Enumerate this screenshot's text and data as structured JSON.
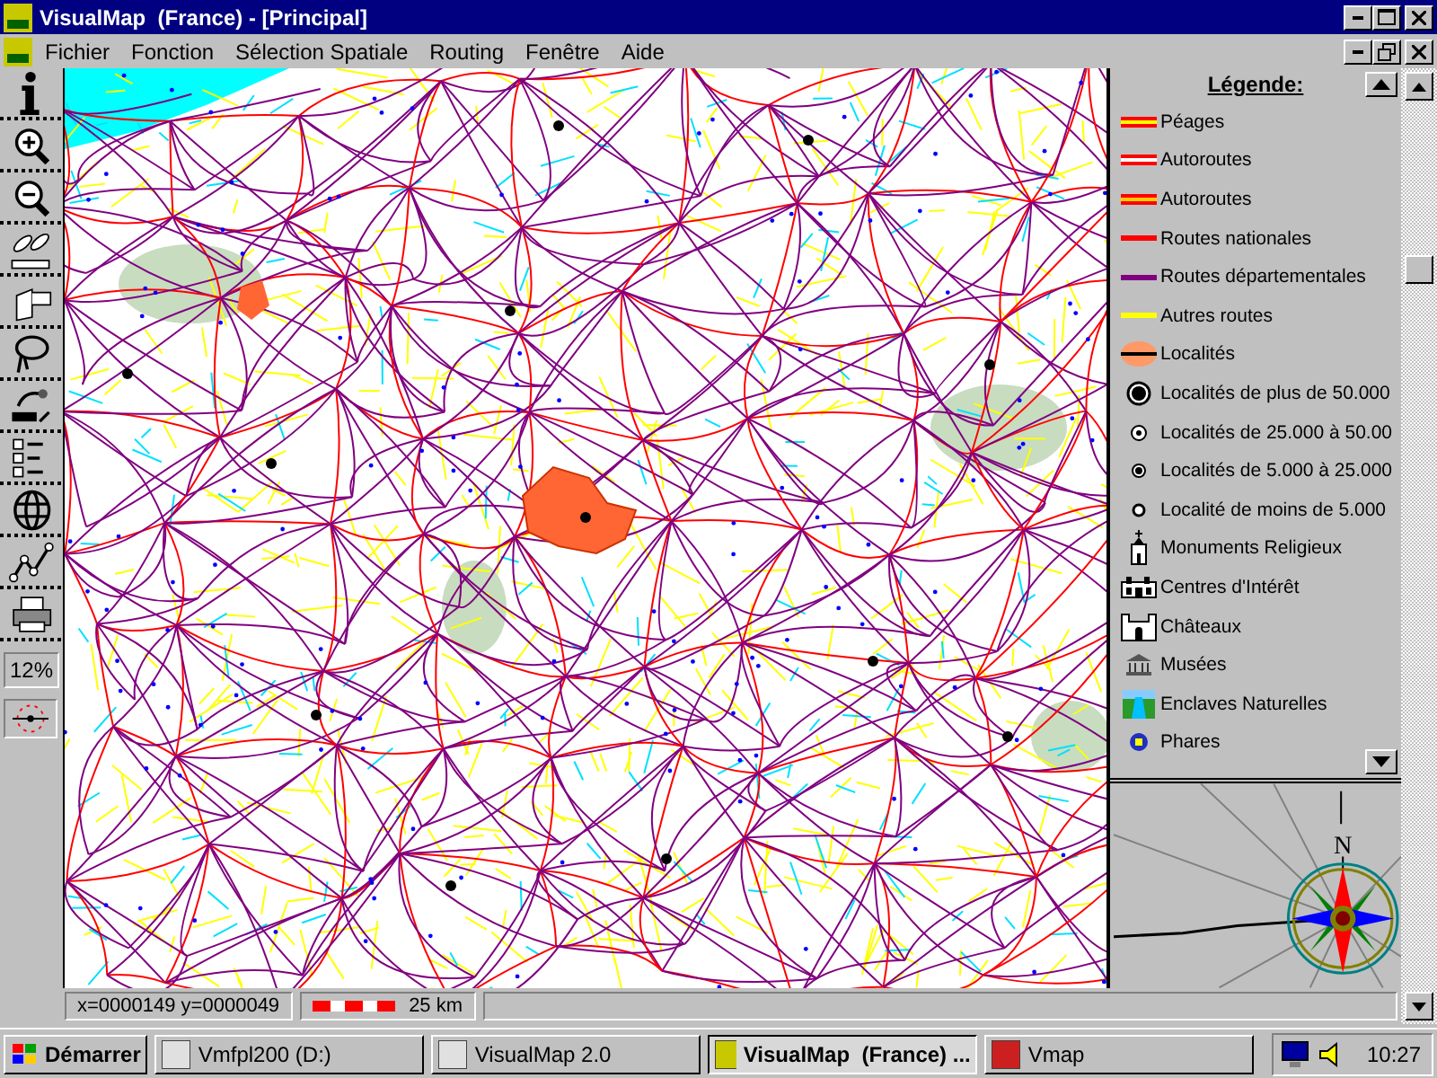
{
  "window": {
    "title": "VisualMap  (France) - [Principal]"
  },
  "menu": [
    {
      "label": "Fichier"
    },
    {
      "label": "Fonction"
    },
    {
      "label": "Sélection Spatiale"
    },
    {
      "label": "Routing"
    },
    {
      "label": "Fenêtre"
    },
    {
      "label": "Aide"
    }
  ],
  "toolbar": {
    "zoom_level": "12%"
  },
  "legend": {
    "title": "Légende:",
    "items": [
      {
        "label": "Péages",
        "kind": "cased",
        "color": "#ffff00"
      },
      {
        "label": "Autoroutes",
        "kind": "cased",
        "color": "#ffffff"
      },
      {
        "label": "Autoroutes",
        "kind": "cased",
        "color": "#ffcc00"
      },
      {
        "label": "Routes nationales",
        "kind": "line",
        "color": "#ff0000"
      },
      {
        "label": "Routes départementales",
        "kind": "line",
        "color": "#800080"
      },
      {
        "label": "Autres routes",
        "kind": "line",
        "color": "#ffff00"
      },
      {
        "label": "Localités",
        "kind": "area"
      },
      {
        "label": "Localités de plus de 50.000",
        "kind": "dot-large"
      },
      {
        "label": "Localités de 25.000 à 50.00",
        "kind": "dot-medium"
      },
      {
        "label": "Localités de 5.000 à 25.000",
        "kind": "dot-small"
      },
      {
        "label": "Localité de moins de 5.000",
        "kind": "dot-tiny"
      },
      {
        "label": "Monuments Religieux",
        "kind": "church"
      },
      {
        "label": "Centres d'Intérêt",
        "kind": "landmark"
      },
      {
        "label": "Châteaux",
        "kind": "castle"
      },
      {
        "label": "Musées",
        "kind": "museum"
      },
      {
        "label": "Enclaves Naturelles",
        "kind": "nature"
      },
      {
        "label": "Phares",
        "kind": "lighthouse"
      }
    ]
  },
  "compass": {
    "north_label": "N"
  },
  "status_bar": {
    "coordinates": "x=0000149 y=0000049",
    "scale": "25 km"
  },
  "taskbar": {
    "start": "Démarrer",
    "tasks": [
      {
        "label": "Vmfpl200 (D:)",
        "selected": false
      },
      {
        "label": "VisualMap 2.0",
        "selected": false
      },
      {
        "label": "VisualMap  (France) ...",
        "selected": true
      },
      {
        "label": "Vmap",
        "selected": false
      }
    ],
    "clock": "10:27"
  }
}
